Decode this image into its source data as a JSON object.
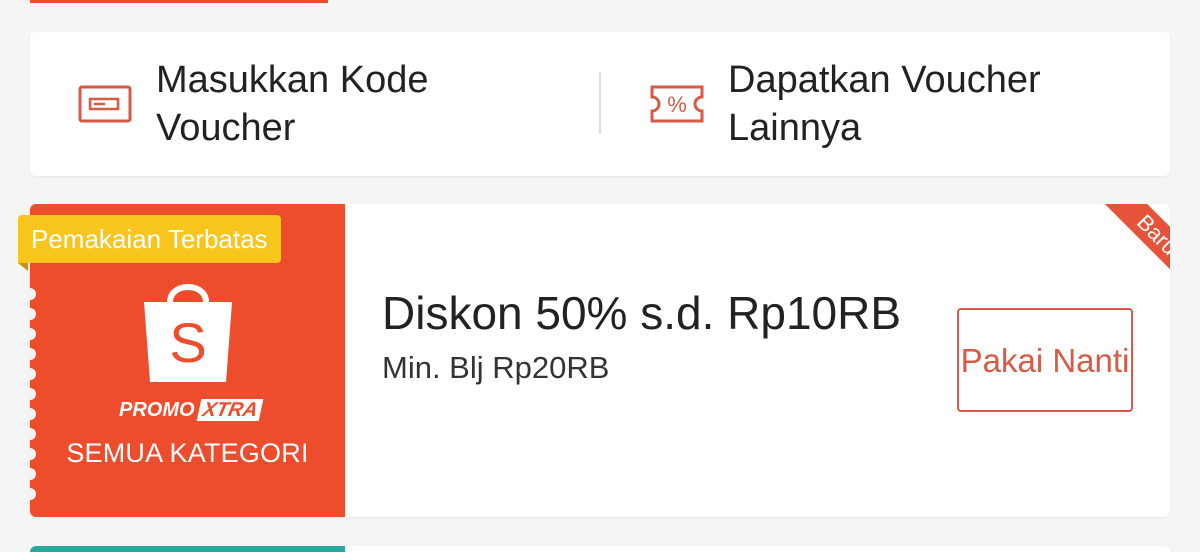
{
  "voucher_actions": {
    "enter_code": {
      "label": "Masukkan Kode Voucher",
      "icon": "voucher-code-icon"
    },
    "more_vouchers": {
      "label": "Dapatkan Voucher Lainnya",
      "icon": "percent-ticket-icon"
    }
  },
  "voucher": {
    "badge": "Pemakaian Terbatas",
    "new_ribbon": "Baru",
    "promo_label": "PROMO",
    "promo_xtra": "XTRA",
    "category": "SEMUA KATEGORI",
    "title": "Diskon 50% s.d. Rp10RB",
    "min_spend": "Min. Blj Rp20RB",
    "button_label": "Pakai Nanti",
    "logo_letter": "S"
  },
  "colors": {
    "brand": "#ee4d2d",
    "badge": "#f8c51c",
    "button_text": "#d65a45",
    "next_card_accent": "#26aa99"
  }
}
